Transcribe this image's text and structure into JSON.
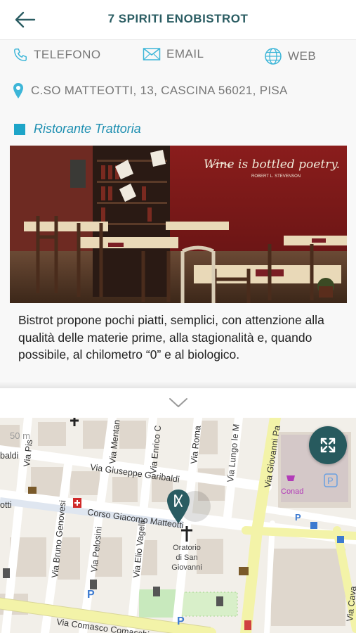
{
  "header": {
    "title": "7 SPIRITI ENOBISTROT"
  },
  "contacts": {
    "phone_label": "TELEFONO",
    "email_label": "EMAIL",
    "web_label": "WEB"
  },
  "address": "C.SO MATTEOTTI, 13, CASCINA 56021, PISA",
  "category": "Ristorante Trattoria",
  "photo": {
    "overlay_text": "Wine is bottled poetry.",
    "overlay_author": "ROBERT L. STEVENSON"
  },
  "description": "Bistrot propone pochi piatti, semplici, con attenzione alla qualità delle materie prime, alla stagionalità e, quando possibile, al chilometro “0” e al biologico.",
  "map": {
    "streets": [
      "Via Giuseppe Garibaldi",
      "Corso Giacomo Matteotti",
      "Via Comasco Comaschi",
      "Via Bruno Genovesi",
      "Via Pelosini",
      "Via Elio Vagelli",
      "Via Enrico C",
      "Via Roma",
      "Via Lungo le M",
      "Via Giovanni Pa",
      "Via Mentan",
      "Via Giovanni P",
      "Via Cava",
      "Via Pis"
    ],
    "poi_label": "Oratorio di San Giovanni",
    "poi_line1": "Oratorio",
    "poi_line2": "di San",
    "poi_line3": "Giovanni",
    "shop_label": "Conad",
    "scale_label": "50 m",
    "frag_left1": "baldi",
    "frag_left2": "otti",
    "pin_color": "#2a5c62"
  },
  "colors": {
    "accent": "#2a5c62",
    "category": "#1ea5c8",
    "icon": "#3db6d8"
  }
}
